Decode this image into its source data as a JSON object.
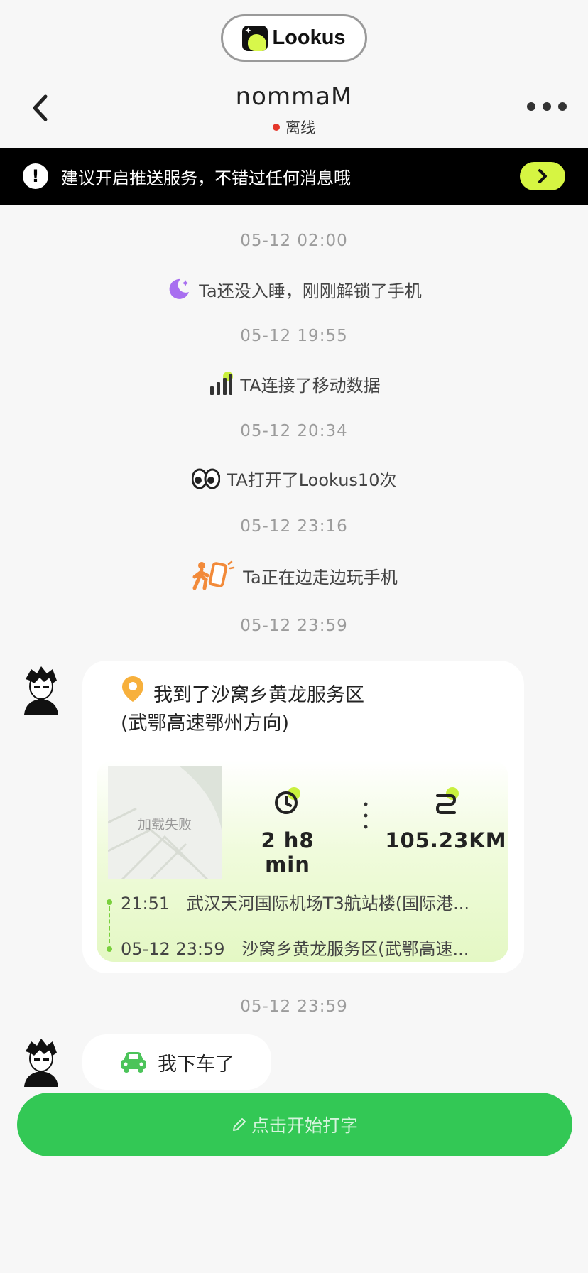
{
  "brand": {
    "name": "Lookus"
  },
  "header": {
    "title": "nommaM",
    "status": "离线",
    "status_color": "#e5372b"
  },
  "banner": {
    "text": "建议开启推送服务，不错过任何消息哦",
    "accent": "#d6f542"
  },
  "messages": [
    {
      "time": "05-12 02:00",
      "text": "Ta还没入睡，刚刚解锁了手机",
      "icon": "moon-icon"
    },
    {
      "time": "05-12 19:55",
      "text": "TA连接了移动数据",
      "icon": "signal-icon"
    },
    {
      "time": "05-12 20:34",
      "text": "TA打开了Lookus10次",
      "icon": "eyes-icon"
    },
    {
      "time": "05-12 23:16",
      "text": "Ta正在边走边玩手机",
      "icon": "walking-phone-icon"
    }
  ],
  "trip": {
    "time": "05-12 23:59",
    "title_line1": "我到了沙窝乡黄龙服务区",
    "title_line2": "(武鄂高速鄂州方向)",
    "map_label": "加载失败",
    "duration": "2 h8 min",
    "distance": "105.23KM",
    "from_time": "21:51",
    "from_place": "武汉天河国际机场T3航站楼(国际港...",
    "to_time": "05-12 23:59",
    "to_place": "沙窝乡黄龙服务区(武鄂高速..."
  },
  "car_message": {
    "time": "05-12 23:59",
    "text": "我下车了"
  },
  "input": {
    "placeholder": "点击开始打字",
    "color": "#33c855"
  }
}
